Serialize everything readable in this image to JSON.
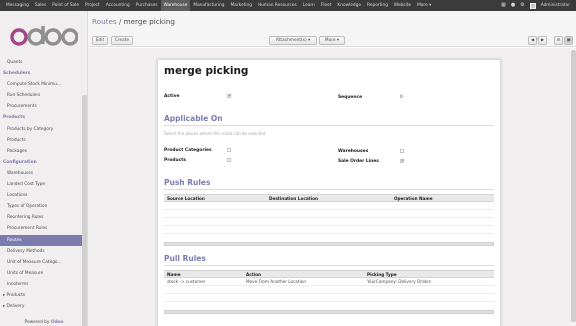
{
  "topbar": {
    "menu": [
      "Messaging",
      "Sales",
      "Point of Sale",
      "Project",
      "Accounting",
      "Purchases",
      "Warehouse",
      "Manufacturing",
      "Marketing",
      "Human Resources",
      "Learn",
      "Fleet",
      "Knowledge",
      "Reporting",
      "Website",
      "More ▾"
    ],
    "active": "Warehouse",
    "user": "Administrator"
  },
  "sidebar": {
    "powered_prefix": "Powered by",
    "powered_brand": "Odoo",
    "items": [
      {
        "label": "Quants",
        "kind": "item"
      },
      {
        "label": "Schedulers",
        "kind": "section"
      },
      {
        "label": "Compute Stock Minimu...",
        "kind": "item"
      },
      {
        "label": "Run Schedulers",
        "kind": "item"
      },
      {
        "label": "Procurements",
        "kind": "item"
      },
      {
        "label": "Products",
        "kind": "section"
      },
      {
        "label": "Products by Category",
        "kind": "item"
      },
      {
        "label": "Products",
        "kind": "item"
      },
      {
        "label": "Packages",
        "kind": "item"
      },
      {
        "label": "Configuration",
        "kind": "section"
      },
      {
        "label": "Warehouses",
        "kind": "item"
      },
      {
        "label": "Landed Cost Type",
        "kind": "item"
      },
      {
        "label": "Locations",
        "kind": "item"
      },
      {
        "label": "Types of Operation",
        "kind": "item"
      },
      {
        "label": "Reordering Rules",
        "kind": "item"
      },
      {
        "label": "Procurement Rules",
        "kind": "item"
      },
      {
        "label": "Routes",
        "kind": "active"
      },
      {
        "label": "Delivery Methods",
        "kind": "item"
      },
      {
        "label": "Unit of Measure Catego...",
        "kind": "item"
      },
      {
        "label": "Units of Measure",
        "kind": "item"
      },
      {
        "label": "Incoterms",
        "kind": "item"
      },
      {
        "label": "Products",
        "kind": "tree"
      },
      {
        "label": "Delivery",
        "kind": "tree"
      }
    ]
  },
  "header": {
    "breadcrumb_link": "Routes",
    "breadcrumb_sep": "/",
    "breadcrumb_current": "merge picking",
    "edit_label": "Edit",
    "create_label": "Create",
    "attachments_label": "Attachment(s) ▾",
    "more_label": "More ▾",
    "pager": "1 / 9"
  },
  "form": {
    "title": "merge picking",
    "active_label": "Active",
    "active_checked": true,
    "sequence_label": "Sequence",
    "sequence_value": "0",
    "applicable_heading": "Applicable On",
    "applicable_help": "Select the places where this route can be selected",
    "product_categories_label": "Product Categories",
    "product_categories_checked": false,
    "products_label": "Products",
    "products_checked": false,
    "warehouses_label": "Warehouses",
    "warehouses_checked": false,
    "sale_order_lines_label": "Sale Order Lines",
    "sale_order_lines_checked": true,
    "push_heading": "Push Rules",
    "push_columns": [
      "Source Location",
      "Destination Location",
      "Operation Name"
    ],
    "pull_heading": "Pull Rules",
    "pull_columns": [
      "Name",
      "Action",
      "Picking Type"
    ],
    "pull_rows": [
      {
        "name": "stock -> customer",
        "action": "Move From Another Location",
        "picking_type": "YourCompany: Delivery Orders"
      }
    ]
  }
}
